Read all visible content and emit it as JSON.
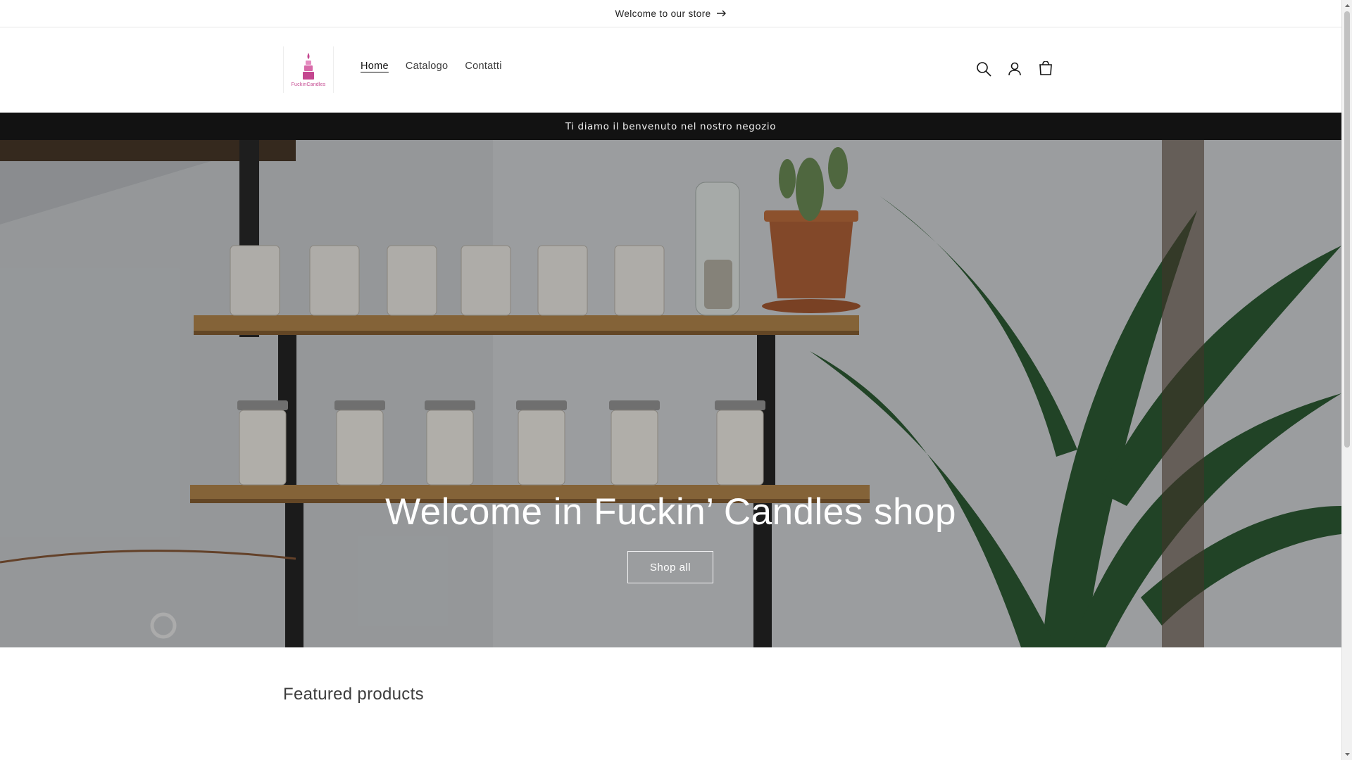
{
  "announcement": {
    "text": "Welcome to our store",
    "arrow_icon": "arrow-right-icon"
  },
  "header": {
    "logo_text": "FuckinCandles",
    "nav": [
      {
        "label": "Home",
        "active": true
      },
      {
        "label": "Catalogo",
        "active": false
      },
      {
        "label": "Contatti",
        "active": false
      }
    ],
    "icons": [
      "search-icon",
      "account-icon",
      "cart-icon"
    ]
  },
  "banner": {
    "text": "Ti diamo il benvenuto nel nostro negozio"
  },
  "hero": {
    "title": "Welcome in Fuckin’ Candles shop",
    "button_label": "Shop all"
  },
  "featured": {
    "title": "Featured products"
  },
  "colors": {
    "text": "#121212",
    "banner_bg": "#121212",
    "logo_pink": "#c4468f",
    "white": "#ffffff"
  }
}
